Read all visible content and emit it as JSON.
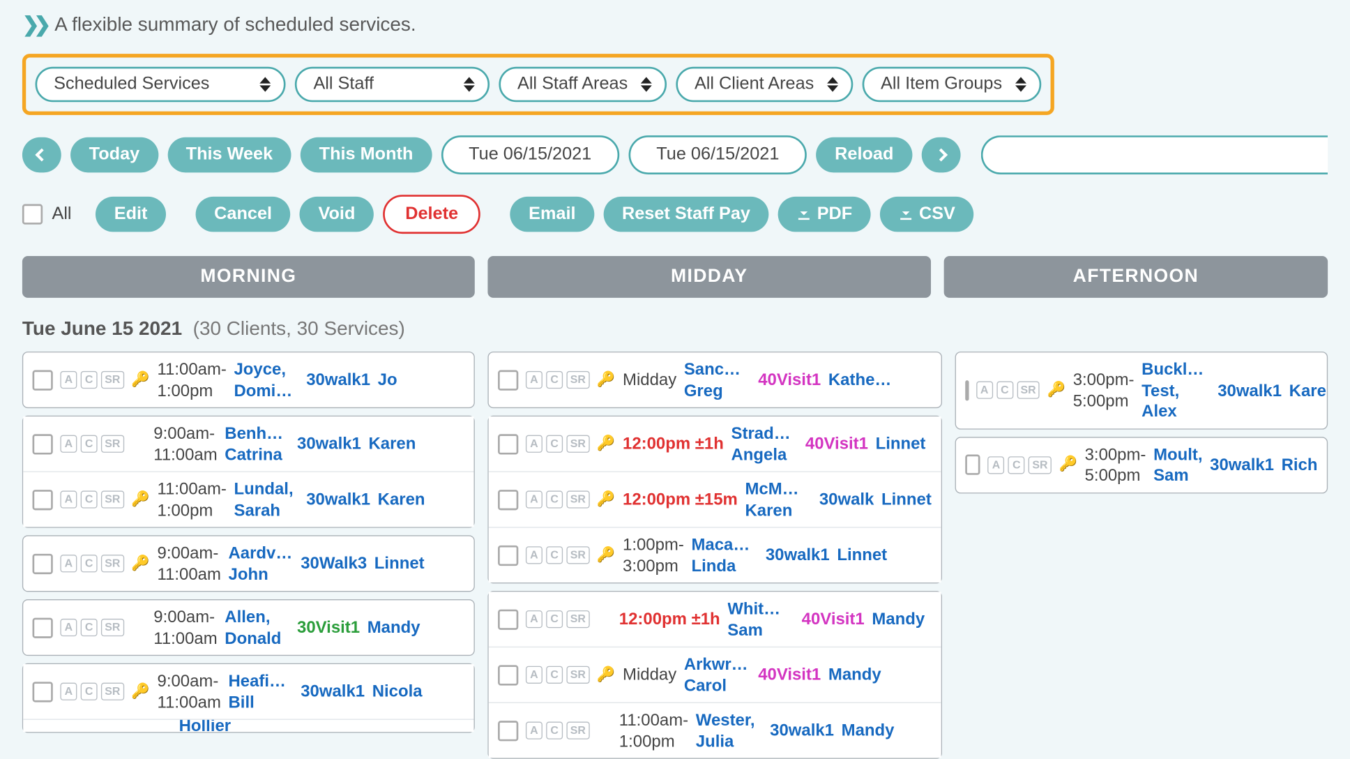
{
  "subtitle": "A flexible summary of scheduled services.",
  "filters": {
    "service": "Scheduled Services",
    "staff": "All Staff",
    "staff_areas": "All Staff Areas",
    "client_areas": "All Client Areas",
    "item_groups": "All Item Groups"
  },
  "datebar": {
    "today": "Today",
    "this_week": "This Week",
    "this_month": "This Month",
    "from": "Tue 06/15/2021",
    "to": "Tue 06/15/2021",
    "reload": "Reload"
  },
  "actions": {
    "all": "All",
    "edit": "Edit",
    "cancel": "Cancel",
    "void": "Void",
    "delete": "Delete",
    "email": "Email",
    "reset": "Reset Staff Pay",
    "pdf": "PDF",
    "csv": "CSV"
  },
  "periods": {
    "morning": "MORNING",
    "midday": "MIDDAY",
    "afternoon": "AFTERNOON"
  },
  "date_label": "Tue June 15 2021",
  "date_counts": "(30 Clients, 30 Services)",
  "badges": {
    "a": "A",
    "c": "C",
    "sr": "SR"
  },
  "morning": [
    {
      "t1": "11:00am-",
      "t2": "1:00pm",
      "cl1": "Joyce,",
      "cl2": "Domi…",
      "svc": "30walk1",
      "svc_cls": "blue",
      "staff": "Jo",
      "key": true
    },
    {
      "t1": "9:00am-",
      "t2": "11:00am",
      "cl1": "Benha…",
      "cl2": "Catrina",
      "svc": "30walk1",
      "svc_cls": "blue",
      "staff": "Karen",
      "key": false
    },
    {
      "t1": "11:00am-",
      "t2": "1:00pm",
      "cl1": "Lundal,",
      "cl2": "Sarah",
      "svc": "30walk1",
      "svc_cls": "blue",
      "staff": "Karen",
      "key": true
    },
    {
      "t1": "9:00am-",
      "t2": "11:00am",
      "cl1": "Aardv…",
      "cl2": "John",
      "svc": "30Walk3",
      "svc_cls": "blue",
      "staff": "Linnet",
      "key": true
    },
    {
      "t1": "9:00am-",
      "t2": "11:00am",
      "cl1": "Allen,",
      "cl2": "Donald",
      "svc": "30Visit1",
      "svc_cls": "green",
      "staff": "Mandy",
      "key": false
    },
    {
      "t1": "9:00am-",
      "t2": "11:00am",
      "cl1": "Heafie…",
      "cl2": "Bill",
      "svc": "30walk1",
      "svc_cls": "blue",
      "staff": "Nicola",
      "key": true
    }
  ],
  "morning_tail_client": "Hollier",
  "midday": [
    {
      "time": "Midday",
      "red": false,
      "cl1": "Sanch…",
      "cl2": "Greg",
      "svc": "40Visit1",
      "svc_cls": "magenta",
      "staff": "Kathe…",
      "key": true
    },
    {
      "time": "12:00pm ±1h",
      "red": true,
      "cl1": "Strad…",
      "cl2": "Angela",
      "svc": "40Visit1",
      "svc_cls": "magenta",
      "staff": "Linnet",
      "key": true
    },
    {
      "time": "12:00pm ±15m",
      "red": true,
      "cl1": "McM…",
      "cl2": "Karen",
      "svc": "30walk",
      "svc_cls": "blue",
      "staff": "Linnet",
      "key": true
    },
    {
      "time": "1:00pm-\n3:00pm",
      "red": false,
      "cl1": "Macau…",
      "cl2": "Linda",
      "svc": "30walk1",
      "svc_cls": "blue",
      "staff": "Linnet",
      "key": true
    },
    {
      "time": "12:00pm ±1h",
      "red": true,
      "cl1": "Whit…",
      "cl2": "Sam",
      "svc": "40Visit1",
      "svc_cls": "magenta",
      "staff": "Mandy",
      "key": false
    },
    {
      "time": "Midday",
      "red": false,
      "cl1": "Arkwri…",
      "cl2": "Carol",
      "svc": "40Visit1",
      "svc_cls": "magenta",
      "staff": "Mandy",
      "key": true
    },
    {
      "time": "11:00am-\n1:00pm",
      "red": false,
      "cl1": "Wester,",
      "cl2": "Julia",
      "svc": "30walk1",
      "svc_cls": "blue",
      "staff": "Mandy",
      "key": false
    }
  ],
  "afternoon": [
    {
      "t1": "3:00pm-",
      "t2": "5:00pm",
      "cl1": "Buckla…",
      "cl2": "Test,",
      "cl3": "Alex",
      "svc": "30walk1",
      "svc_cls": "blue",
      "staff": "Kare",
      "key": true
    },
    {
      "t1": "3:00pm-",
      "t2": "5:00pm",
      "cl1": "Moult,",
      "cl2": "Sam",
      "cl3": "",
      "svc": "30walk1",
      "svc_cls": "blue",
      "staff": "Rich",
      "key": true
    }
  ]
}
